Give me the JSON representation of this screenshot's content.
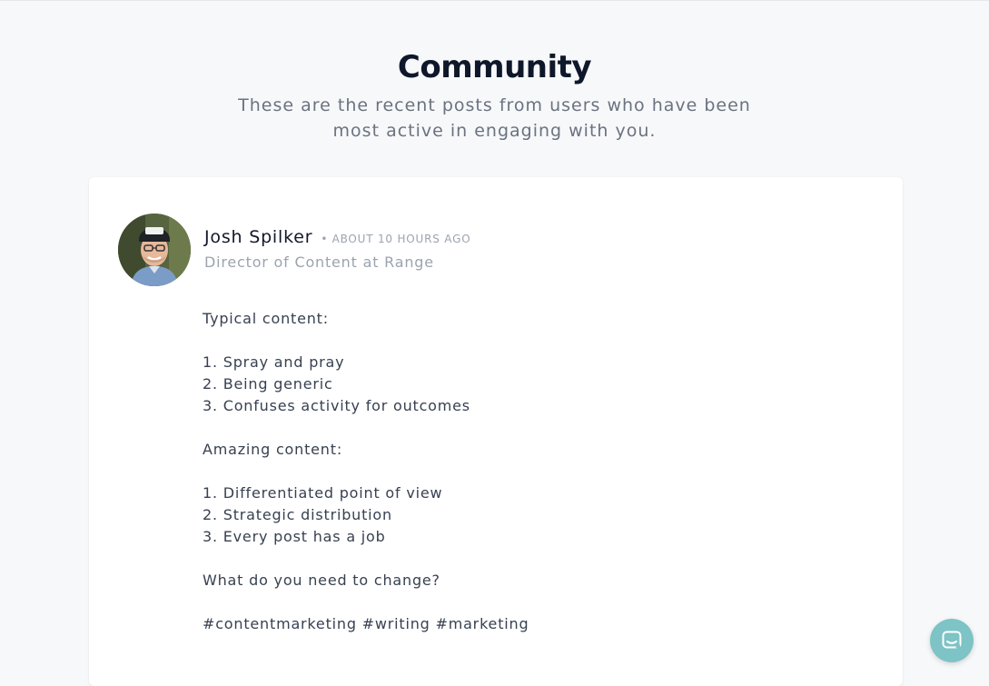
{
  "page": {
    "title": "Community",
    "subtitle": "These are the recent posts from users who have been most active in engaging with you."
  },
  "post": {
    "author_name": "Josh Spilker",
    "separator": "•",
    "timestamp": "ABOUT 10 HOURS AGO",
    "author_role": "Director of Content at Range",
    "body_lines": [
      "Typical content:",
      "",
      "1. Spray and pray",
      "2. Being generic",
      "3. Confuses activity for outcomes",
      "",
      "Amazing content:",
      "",
      "1. Differentiated point of view",
      "2. Strategic distribution",
      "3. Every post has a job",
      "",
      "What do you need to change?",
      "",
      "#contentmarketing #writing #marketing"
    ]
  },
  "icons": {
    "chat": "chat-bubble-icon",
    "avatar": "user-avatar"
  },
  "colors": {
    "background": "#f7f8fa",
    "card": "#ffffff",
    "chat_button": "#7ec3c6",
    "title": "#0f172a",
    "muted": "#9ca3af"
  }
}
